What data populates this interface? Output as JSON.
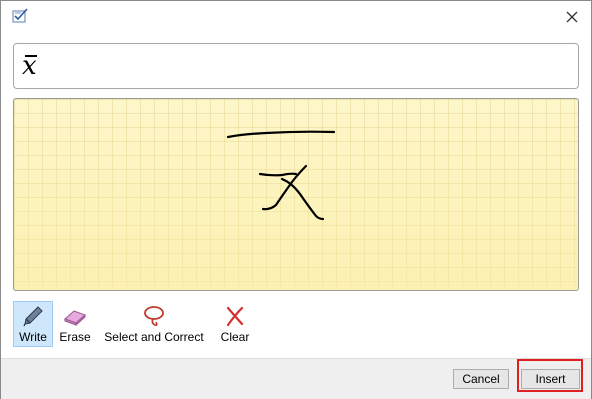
{
  "window": {
    "icon": "math-input-icon",
    "close_icon": "close-icon"
  },
  "preview": {
    "expression_char": "x",
    "expression": "x̄"
  },
  "canvas": {
    "background": "#fdf6c9",
    "grid_color": "#d6c478",
    "ink_color": "#000000"
  },
  "toolbar": {
    "tools": [
      {
        "name": "write",
        "label": "Write",
        "icon": "pen-icon",
        "active": true
      },
      {
        "name": "erase",
        "label": "Erase",
        "icon": "eraser-icon",
        "active": false
      },
      {
        "name": "select-correct",
        "label": "Select and Correct",
        "icon": "lasso-icon",
        "active": false
      },
      {
        "name": "clear",
        "label": "Clear",
        "icon": "clear-x-icon",
        "active": false
      }
    ]
  },
  "footer": {
    "cancel_label": "Cancel",
    "insert_label": "Insert",
    "highlight_color": "#e02020"
  }
}
